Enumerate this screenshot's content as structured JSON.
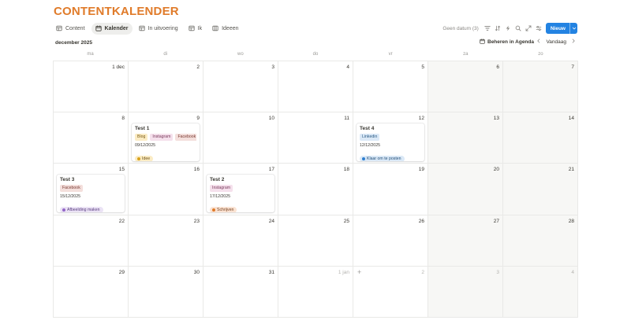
{
  "page": {
    "title": "CONTENTKALENDER"
  },
  "tabs": [
    {
      "label": "Content",
      "icon": "table-icon",
      "active": false
    },
    {
      "label": "Kalender",
      "icon": "calendar-icon",
      "active": true
    },
    {
      "label": "In uitvoering",
      "icon": "table-icon",
      "active": false
    },
    {
      "label": "Ik",
      "icon": "table-icon",
      "active": false
    },
    {
      "label": "Ideeen",
      "icon": "board-icon",
      "active": false
    }
  ],
  "toolbar": {
    "no_date_label": "Geen datum (3)",
    "new_label": "Nieuw",
    "icons": [
      "filter-icon",
      "sort-icon",
      "lightning-icon",
      "search-icon",
      "expand-icon",
      "settings-icon"
    ]
  },
  "calendar": {
    "month_label": "december 2025",
    "manage_label": "Beheren in Agenda",
    "today_label": "Vandaag",
    "weekdays": [
      "ma",
      "di",
      "wo",
      "do",
      "vr",
      "za",
      "zo"
    ],
    "weeks": [
      [
        {
          "label": "1 dec",
          "other": false
        },
        {
          "label": "2",
          "other": false
        },
        {
          "label": "3",
          "other": false
        },
        {
          "label": "4",
          "other": false
        },
        {
          "label": "5",
          "other": false
        },
        {
          "label": "6",
          "other": false
        },
        {
          "label": "7",
          "other": false
        }
      ],
      [
        {
          "label": "8",
          "other": false
        },
        {
          "label": "9",
          "other": false
        },
        {
          "label": "10",
          "other": false
        },
        {
          "label": "11",
          "other": false
        },
        {
          "label": "12",
          "other": false
        },
        {
          "label": "13",
          "other": false
        },
        {
          "label": "14",
          "other": false
        }
      ],
      [
        {
          "label": "15",
          "other": false
        },
        {
          "label": "16",
          "other": false
        },
        {
          "label": "17",
          "other": false
        },
        {
          "label": "18",
          "other": false
        },
        {
          "label": "19",
          "other": false
        },
        {
          "label": "20",
          "other": false
        },
        {
          "label": "21",
          "other": false
        }
      ],
      [
        {
          "label": "22",
          "other": false
        },
        {
          "label": "23",
          "other": false
        },
        {
          "label": "24",
          "other": false
        },
        {
          "label": "25",
          "other": false
        },
        {
          "label": "26",
          "other": false
        },
        {
          "label": "27",
          "other": false
        },
        {
          "label": "28",
          "other": false
        }
      ],
      [
        {
          "label": "29",
          "other": false
        },
        {
          "label": "30",
          "other": false
        },
        {
          "label": "31",
          "other": false
        },
        {
          "label": "1 jan",
          "other": true
        },
        {
          "label": "2",
          "other": true,
          "plus": true
        },
        {
          "label": "3",
          "other": true
        },
        {
          "label": "4",
          "other": true
        }
      ]
    ],
    "events": [
      {
        "week": 1,
        "day": 1,
        "title": "Test 1",
        "tags": [
          {
            "label": "Blog",
            "bg": "#fbecc5",
            "fg": "#7a5a12"
          },
          {
            "label": "Instagram",
            "bg": "#f5e0ec",
            "fg": "#7a3a5c"
          },
          {
            "label": "Facebook",
            "bg": "#f4dfdc",
            "fg": "#7a3a32"
          },
          {
            "label": "",
            "bg": "#dbe9f7",
            "fg": "#2b5a85"
          }
        ],
        "date": "09/12/2025",
        "status": {
          "label": "Idee",
          "bg": "#fbecc5",
          "fg": "#6b4e10",
          "dot": "#d9a21b"
        }
      },
      {
        "week": 1,
        "day": 4,
        "title": "Test 4",
        "tags": [
          {
            "label": "Linkedin",
            "bg": "#dbe9f7",
            "fg": "#2b5a85"
          }
        ],
        "date": "12/12/2025",
        "status": {
          "label": "Klaar om te posten",
          "bg": "#dbe9f7",
          "fg": "#24507a",
          "dot": "#2f7fd0"
        }
      },
      {
        "week": 2,
        "day": 0,
        "title": "Test 3",
        "tags": [
          {
            "label": "Facebook",
            "bg": "#f4dfdc",
            "fg": "#7a3a32"
          }
        ],
        "date": "15/12/2025",
        "status": {
          "label": "Afbeelding maken",
          "bg": "#ebe3f5",
          "fg": "#5a3d80",
          "dot": "#9468c8"
        }
      },
      {
        "week": 2,
        "day": 2,
        "title": "Test 2",
        "tags": [
          {
            "label": "Instagram",
            "bg": "#f5e0ec",
            "fg": "#7a3a5c"
          }
        ],
        "date": "17/12/2025",
        "status": {
          "label": "Schrijven",
          "bg": "#fae3d3",
          "fg": "#7a4220",
          "dot": "#e07b2a"
        }
      }
    ]
  }
}
